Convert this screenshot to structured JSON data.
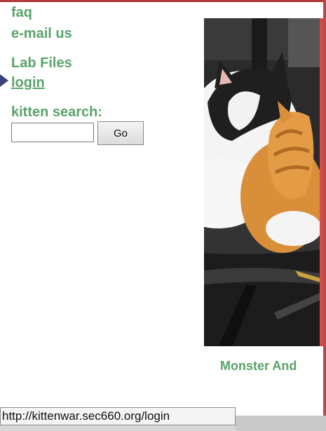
{
  "nav": {
    "faq": "faq",
    "email": "e-mail us",
    "lab_files": "Lab Files",
    "login": "login"
  },
  "search": {
    "label": "kitten search:",
    "value": "",
    "placeholder": "",
    "go_label": "Go"
  },
  "photo": {
    "caption": "Monster And"
  },
  "status_bar": {
    "url": "http://kittenwar.sec660.org/login"
  },
  "colors": {
    "link_green": "#5aa36a",
    "accent_red": "#b33a3a"
  }
}
